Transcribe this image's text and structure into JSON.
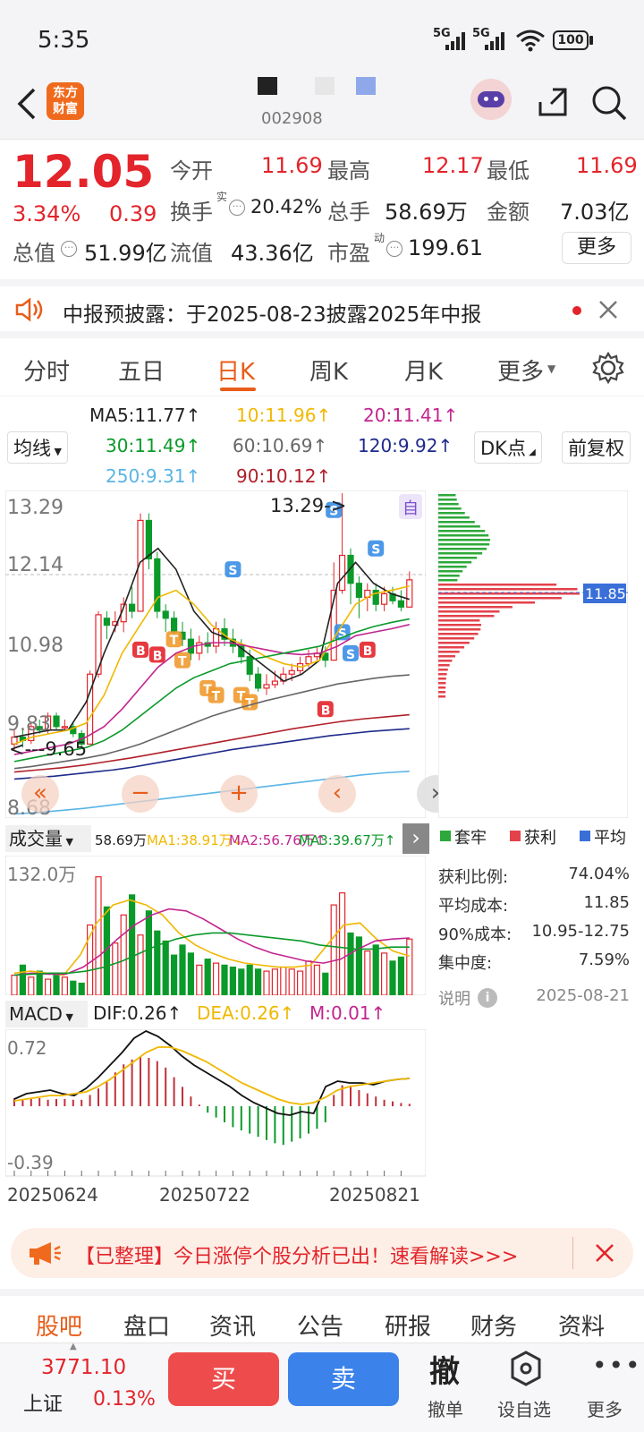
{
  "status_bar": {
    "time": "5:35",
    "network1": "5G",
    "network2": "5G",
    "battery": "100"
  },
  "header": {
    "logo_line1": "东方",
    "logo_line2": "财富",
    "code": "002908"
  },
  "quote": {
    "price": "12.05",
    "change_pct": "3.34%",
    "change_abs": "0.39",
    "open_label": "今开",
    "open": "11.69",
    "high_label": "最高",
    "high": "12.17",
    "low_label": "最低",
    "low": "11.69",
    "turnover_label": "换手",
    "turnover_sup": "实",
    "turnover": "20.42%",
    "volume_label": "总手",
    "volume": "58.69万",
    "amount_label": "金额",
    "amount": "7.03亿",
    "mktcap_label": "总值",
    "mktcap": "51.99亿",
    "float_label": "流值",
    "float": "43.36亿",
    "pe_label": "市盈",
    "pe_sup": "动",
    "pe": "199.61",
    "more": "更多"
  },
  "notice": {
    "text": "中报预披露：于2025-08-23披露2025年中报"
  },
  "chart_tabs": [
    {
      "label": "分时"
    },
    {
      "label": "五日"
    },
    {
      "label": "日K"
    },
    {
      "label": "周K"
    },
    {
      "label": "月K"
    },
    {
      "label": "更多"
    }
  ],
  "ma": {
    "selector": "均线",
    "ma5": "MA5:11.77↑",
    "ma10": "10:11.96↑",
    "ma20": "20:11.41↑",
    "ma30": "30:11.49↑",
    "ma60": "60:10.69↑",
    "ma120": "120:9.92↑",
    "ma250": "250:9.31↑",
    "ma90": "90:10.12↑",
    "dk": "DK点",
    "adjust": "前复权"
  },
  "colors": {
    "up": "#e3242b",
    "down": "#0a9a2a",
    "accent": "#e85d1a",
    "ma5": "#222222",
    "ma10": "#f0b800",
    "ma20": "#c2258f",
    "ma30": "#0a9a2a",
    "ma60": "#666666",
    "ma120": "#1e2a8a",
    "ma250": "#5ab4e6",
    "ma90": "#b0202a"
  },
  "kchart": {
    "y_max": "13.29",
    "y_mid": "12.14",
    "y_low": "10.98",
    "y_9": "9.83",
    "y_min": "8.68",
    "max_annot": "13.29->",
    "min_annot": "<---9.65",
    "self_badge": "自"
  },
  "chip": {
    "price_tag": "11.85",
    "legend": [
      {
        "label": "套牢"
      },
      {
        "label": "获利"
      },
      {
        "label": "平均"
      }
    ],
    "stats": [
      {
        "label": "获利比例:",
        "value": "74.04%"
      },
      {
        "label": "平均成本:",
        "value": "11.85"
      },
      {
        "label": "90%成本:",
        "value": "10.95-12.75"
      },
      {
        "label": "集中度:",
        "value": "7.59%"
      }
    ],
    "note_label": "说明",
    "date": "2025-08-21"
  },
  "volume": {
    "selector": "成交量",
    "vol": "58.69万",
    "ma1": "MA1:38.91万↓",
    "ma2": "MA2:56.76万↑",
    "ma3": "MA3:39.67万↑",
    "y_max": "132.0万"
  },
  "macd": {
    "selector": "MACD",
    "dif": "DIF:0.26↑",
    "dea": "DEA:0.26↑",
    "m": "M:0.01↑",
    "y_max": "0.72",
    "y_min": "-0.39",
    "dates": [
      "20250624",
      "20250722",
      "20250821"
    ]
  },
  "banner": {
    "text": "【已整理】今日涨停个股分析已出！速看解读>>>"
  },
  "bottom_tabs": [
    {
      "label": "股吧"
    },
    {
      "label": "盘口"
    },
    {
      "label": "资讯"
    },
    {
      "label": "公告"
    },
    {
      "label": "研报"
    },
    {
      "label": "财务"
    },
    {
      "label": "资料"
    }
  ],
  "index": {
    "value": "3771.10",
    "name": "上证",
    "pct": "0.13%"
  },
  "actions": {
    "buy": "买",
    "sell": "卖",
    "cancel_big": "撤",
    "cancel_label": "撤单",
    "watch_label": "设自选",
    "more_label": "更多"
  }
}
